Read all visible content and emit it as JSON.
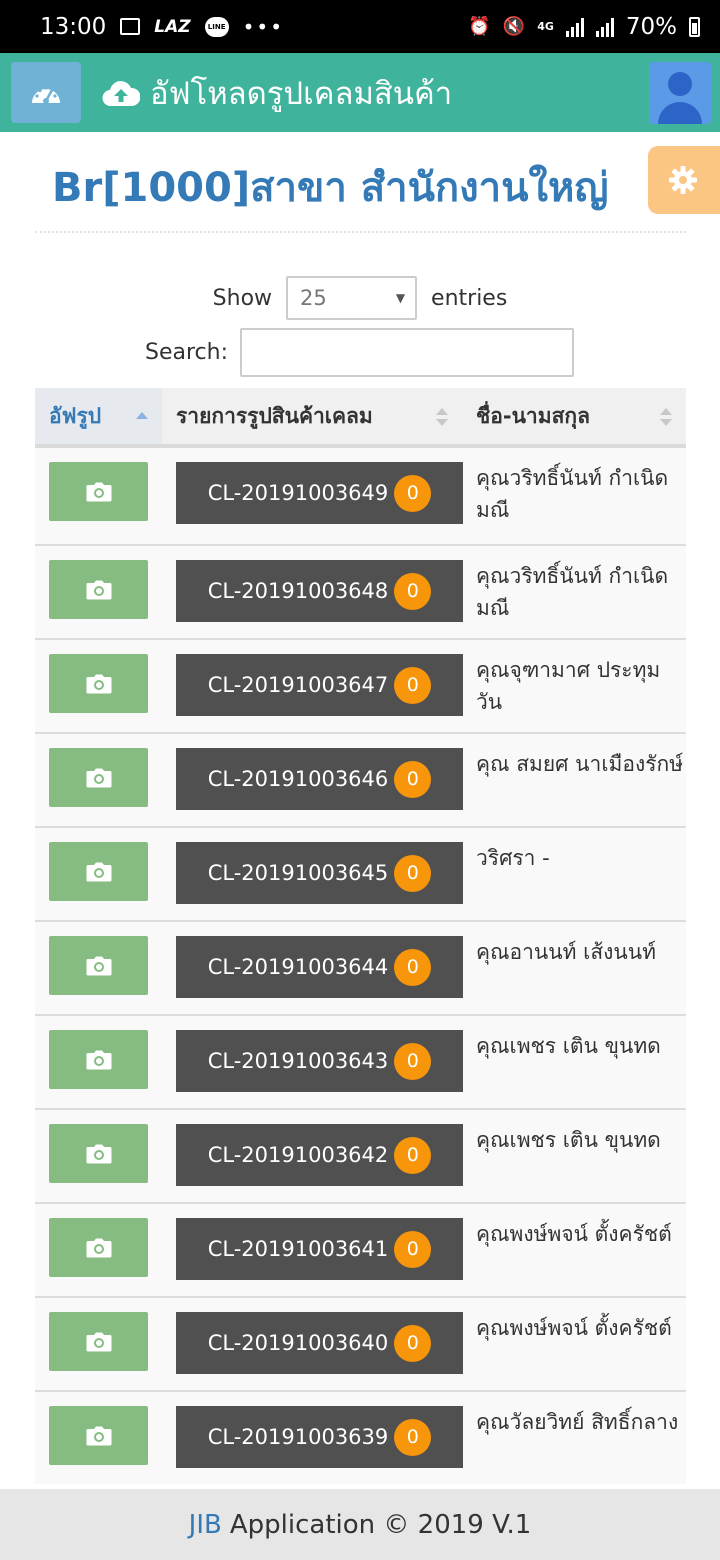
{
  "status_bar": {
    "time": "13:00",
    "laz": "LAZ",
    "line": "LINE",
    "dots": "•••",
    "network": "4G",
    "battery": "70%"
  },
  "app_bar": {
    "title": "อัฟโหลดรูปเคลมสินค้า",
    "icons": {
      "dashboard": "dashboard-icon",
      "upload": "cloud-upload-icon",
      "avatar": "user-avatar-icon"
    }
  },
  "page": {
    "branch_code": "Br",
    "branch_name": "[1000]สาขา สำนักงานใหญ่",
    "settings_icon": "gear-icon"
  },
  "controls": {
    "show_label": "Show",
    "entries_value": "25",
    "entries_label": "entries",
    "search_label": "Search:",
    "search_value": ""
  },
  "table": {
    "columns": [
      "อัฟรูป",
      "รายการรูปสินค้าเคลม",
      "ชื่อ-นามสกุล"
    ],
    "rows": [
      {
        "claim": "CL-20191003649",
        "count": "0",
        "name": "คุณวริทธิ์นันท์ กำเนิดมณี"
      },
      {
        "claim": "CL-20191003648",
        "count": "0",
        "name": "คุณวริทธิ์นันท์ กำเนิดมณี"
      },
      {
        "claim": "CL-20191003647",
        "count": "0",
        "name": "คุณจุฑามาศ ประทุมวัน"
      },
      {
        "claim": "CL-20191003646",
        "count": "0",
        "name": "คุณ สมยศ นาเมืองรักษ์"
      },
      {
        "claim": "CL-20191003645",
        "count": "0",
        "name": "วริศรา -"
      },
      {
        "claim": "CL-20191003644",
        "count": "0",
        "name": "คุณอานนท์ เส้งนนท์"
      },
      {
        "claim": "CL-20191003643",
        "count": "0",
        "name": "คุณเพชร เติน ขุนทด"
      },
      {
        "claim": "CL-20191003642",
        "count": "0",
        "name": "คุณเพชร เติน ขุนทด"
      },
      {
        "claim": "CL-20191003641",
        "count": "0",
        "name": "คุณพงษ์พจน์ ตั้งครัชต์"
      },
      {
        "claim": "CL-20191003640",
        "count": "0",
        "name": "คุณพงษ์พจน์ ตั้งครัชต์"
      },
      {
        "claim": "CL-20191003639",
        "count": "0",
        "name": "คุณวัลยวิทย์ สิทธิ์กลาง"
      }
    ]
  },
  "footer": {
    "brand": "JIB",
    "text": "Application © 2019 V.1"
  },
  "colors": {
    "app_bar": "#3fb39c",
    "camera_button": "#86bb81",
    "claim_button": "#505050",
    "badge": "#f7960b",
    "link_blue": "#337ab7",
    "settings_button": "#fbc583"
  }
}
